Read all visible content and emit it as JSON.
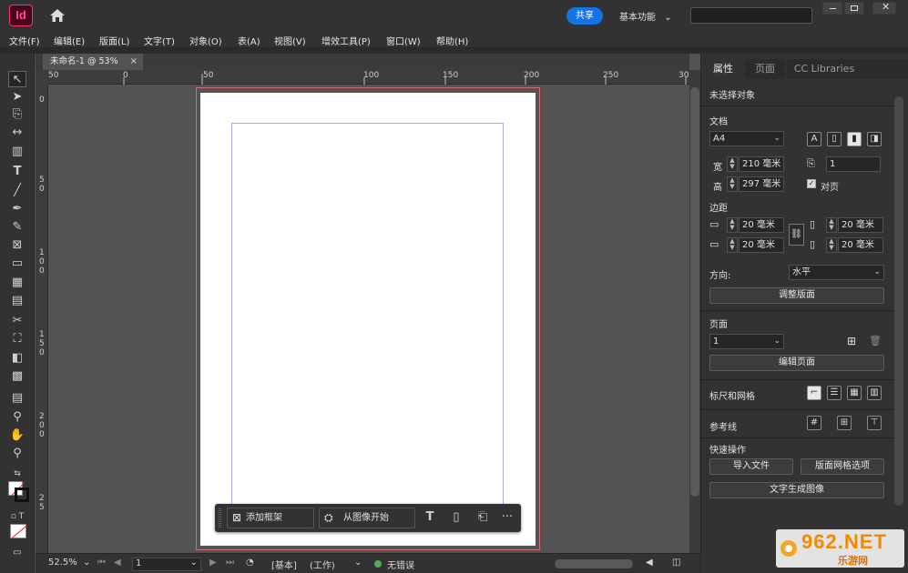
{
  "app": {
    "logo": "Id",
    "share_label": "共享",
    "workspace": "基本功能",
    "workspace_arrow": "⌄"
  },
  "menu": [
    "文件(F)",
    "编辑(E)",
    "版面(L)",
    "文字(T)",
    "对象(O)",
    "表(A)",
    "视图(V)",
    "增效工具(P)",
    "窗口(W)",
    "帮助(H)"
  ],
  "document": {
    "tab_label": "未命名-1 @ 53%",
    "close_glyph": "×"
  },
  "ruler": {
    "h_ticks": [
      "50",
      "0",
      "50",
      "100",
      "150",
      "200",
      "250",
      "30"
    ],
    "v_ticks": [
      "0",
      "5",
      "0",
      "1",
      "0",
      "0",
      "1",
      "5",
      "0",
      "2",
      "0",
      "0",
      "2",
      "5"
    ]
  },
  "context_bar": {
    "add_frame": "添加框架",
    "start_from_image": "从图像开始",
    "more": "···"
  },
  "status": {
    "zoom": "52.5%",
    "page": "1",
    "master": "[基本]",
    "workspace": "(工作)",
    "preflight": "无错误"
  },
  "panel": {
    "tabs": [
      "属性",
      "页面",
      "CC Libraries"
    ],
    "no_selection": "未选择对象",
    "document_section": "文档",
    "page_size": "A4",
    "width_label": "宽",
    "width_value": "210 毫米",
    "height_label": "高",
    "height_value": "297 毫米",
    "pages_value": "1",
    "facing_pages": "对页",
    "margins_section": "边距",
    "margin_top": "20 毫米",
    "margin_bottom": "20 毫米",
    "margin_left": "20 毫米",
    "margin_right": "20 毫米",
    "orientation_label": "方向:",
    "orientation_value": "水平",
    "adjust_layout": "调整版面",
    "pages_section": "页面",
    "page_select": "1",
    "edit_page": "编辑页面",
    "rulers_grids": "标尺和网格",
    "guides": "参考线",
    "quick_actions": "快速操作",
    "import_file": "导入文件",
    "layout_grid_options": "版面网格选项",
    "text_to_image": "文字生成图像"
  },
  "watermark": {
    "brand": "962.NET",
    "sub": "乐游网"
  },
  "colors": {
    "accent": "#1473e6",
    "logo": "#ff3366",
    "bleed": "#d26a7a",
    "margin": "#b7a6d9",
    "status_ok": "#4caf50"
  }
}
